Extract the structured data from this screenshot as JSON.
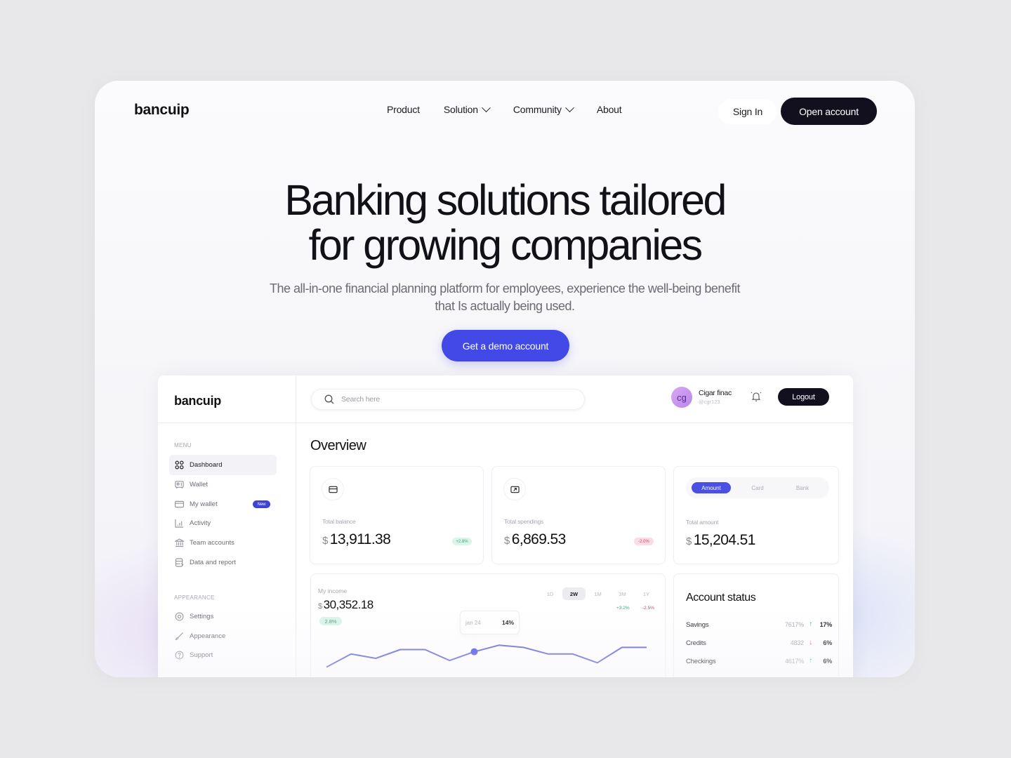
{
  "site": {
    "logo": "bancuip",
    "nav": [
      {
        "label": "Product",
        "has_dropdown": false
      },
      {
        "label": "Solution",
        "has_dropdown": true
      },
      {
        "label": "Community",
        "has_dropdown": true
      },
      {
        "label": "About",
        "has_dropdown": false
      }
    ],
    "sign_in": "Sign In",
    "open_account": "Open account"
  },
  "hero": {
    "title_line1": "Banking solutions tailored",
    "title_line2": "for growing companies",
    "subtitle_line1": "The all-in-one financial planning platform for employees, experience the well-being benefit",
    "subtitle_line2": "that Is actually being used.",
    "cta": "Get a demo account",
    "accent_color": "#4249e6"
  },
  "dashboard": {
    "logo": "bancuip",
    "search_placeholder": "Search here",
    "user": {
      "initials": "cg",
      "name": "Cigar finac",
      "handle": "@cgr123"
    },
    "logout": "Logout",
    "sidebar": {
      "menu_label": "MENU",
      "items": [
        {
          "label": "Dashboard",
          "icon": "grid-icon",
          "active": true
        },
        {
          "label": "Wallet",
          "icon": "wallet-icon"
        },
        {
          "label": "My wallet",
          "icon": "card-icon",
          "badge": "New"
        },
        {
          "label": "Activity",
          "icon": "bar-chart-icon"
        },
        {
          "label": "Team accounts",
          "icon": "bank-icon"
        },
        {
          "label": "Data and report",
          "icon": "database-icon"
        }
      ],
      "appearance_label": "APPEARANCE",
      "appearance_items": [
        {
          "label": "Settings",
          "icon": "settings-icon"
        },
        {
          "label": "Appearance",
          "icon": "brush-icon"
        },
        {
          "label": "Support",
          "icon": "help-icon"
        }
      ]
    },
    "overview_title": "Overview",
    "cards": [
      {
        "label": "Total balance",
        "currency": "$",
        "value": "13,911.38",
        "change": "+2.8%",
        "trend": "up"
      },
      {
        "label": "Total spendings",
        "currency": "$",
        "value": "6,869.53",
        "change": "-2.0%",
        "trend": "down"
      }
    ],
    "amount_card": {
      "tabs": [
        "Amount",
        "Card",
        "Bank"
      ],
      "active_tab": "Amount",
      "label": "Total amount",
      "currency": "$",
      "value": "15,204.51"
    },
    "income": {
      "label": "My income",
      "currency": "$",
      "value": "30,352.18",
      "change": "2.8%",
      "ranges": [
        "1D",
        "2W",
        "1M",
        "3M",
        "1Y"
      ],
      "active_range": "2W",
      "deltas": [
        {
          "value": "+3.2%",
          "trend": "up"
        },
        {
          "value": "-2.5%",
          "trend": "down"
        }
      ],
      "tooltip": {
        "date": "jan 24",
        "value": "14%"
      },
      "line_color": "#5b5fcf"
    },
    "account_status": {
      "title": "Account status",
      "rows": [
        {
          "name": "Savings",
          "raw": "7617%",
          "trend": "up",
          "pct": "17%"
        },
        {
          "name": "Credits",
          "raw": "4832",
          "trend": "down",
          "pct": "6%"
        },
        {
          "name": "Checkings",
          "raw": "4617%",
          "trend": "up",
          "pct": "6%"
        }
      ]
    }
  },
  "chart_data": {
    "type": "line",
    "title": "My income",
    "x": [
      1,
      2,
      3,
      4,
      5,
      6,
      7,
      8,
      9,
      10,
      11,
      12,
      13,
      14
    ],
    "values": [
      4,
      10,
      8,
      12,
      12,
      7,
      11,
      14,
      13,
      10,
      10,
      6,
      13,
      13
    ],
    "highlight": {
      "index": 6,
      "label": "jan 24",
      "value": "14%"
    },
    "ylim": [
      0,
      16
    ],
    "grid": false,
    "legend": "none"
  }
}
